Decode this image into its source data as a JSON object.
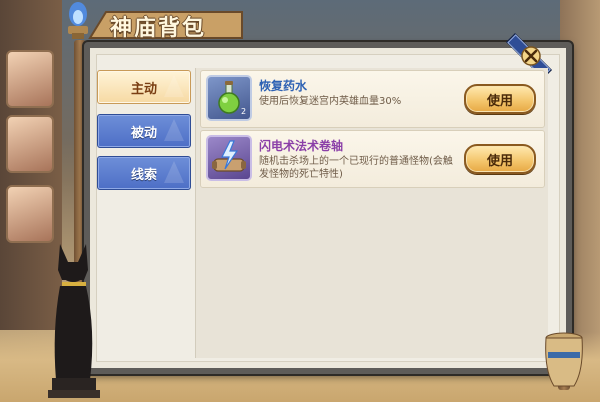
{
  "window": {
    "title": "神庙背包"
  },
  "tabs": [
    {
      "label": "主动",
      "active": true
    },
    {
      "label": "被动",
      "active": false
    },
    {
      "label": "线索",
      "active": false
    }
  ],
  "items": [
    {
      "name": "恢复药水",
      "name_color": "#2e62b4",
      "quantity": "2",
      "description": "使用后恢复迷宫内英雄血量30%",
      "button_label": "使用",
      "icon": "potion-icon"
    },
    {
      "name": "闪电术法术卷轴",
      "name_color": "#8b3fa8",
      "description": "随机击杀场上的一个已现行的普通怪物(会触发怪物的死亡特性)",
      "button_label": "使用",
      "icon": "lightning-scroll-icon"
    }
  ],
  "colors": {
    "active_tab": "#f6d9a3",
    "inactive_tab": "#5a7bd0",
    "button": "#f3c46a"
  }
}
